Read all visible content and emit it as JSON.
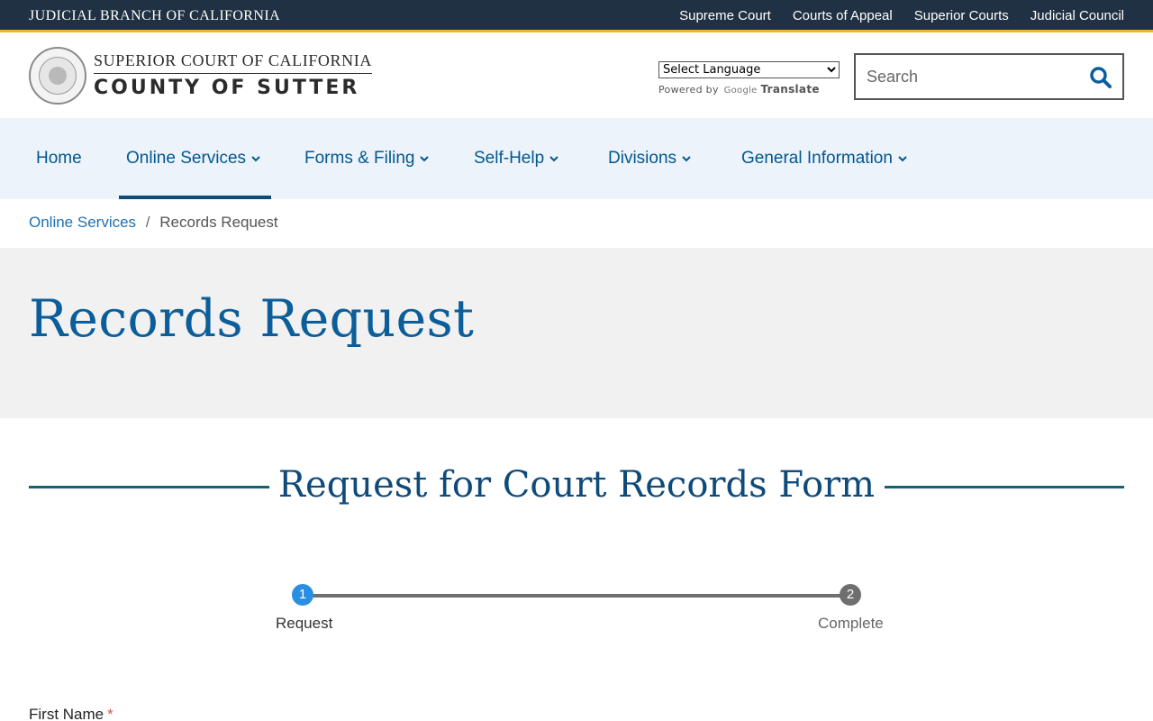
{
  "topbar": {
    "brand": "JUDICIAL BRANCH OF CALIFORNIA",
    "links": [
      "Supreme Court",
      "Courts of Appeal",
      "Superior Courts",
      "Judicial Council"
    ]
  },
  "header": {
    "logo_line1": "SUPERIOR COURT OF CALIFORNIA",
    "logo_line2": "COUNTY OF SUTTER",
    "language_select_value": "Select Language",
    "powered_by": "Powered by",
    "google": "Google",
    "translate": "Translate",
    "search_placeholder": "Search"
  },
  "nav": {
    "items": [
      {
        "label": "Home"
      },
      {
        "label": "Online Services"
      },
      {
        "label": "Forms & Filing"
      },
      {
        "label": "Self-Help"
      },
      {
        "label": "Divisions"
      },
      {
        "label": "General Information"
      }
    ]
  },
  "breadcrumb": {
    "parent": "Online Services",
    "separator": "/",
    "current": "Records Request"
  },
  "page": {
    "title": "Records Request",
    "form_title": "Request for Court Records Form"
  },
  "steps": {
    "items": [
      {
        "number": "1",
        "label": "Request"
      },
      {
        "number": "2",
        "label": "Complete"
      }
    ]
  },
  "form": {
    "first_name_label": "First Name",
    "required_mark": "*"
  },
  "colors": {
    "topbar": "#1f3142",
    "accent_gold": "#f0b429",
    "nav_bg": "#ecf3fa",
    "link_blue": "#04578f",
    "title_blue": "#0b5e9a",
    "step_active": "#2a8fe0"
  }
}
